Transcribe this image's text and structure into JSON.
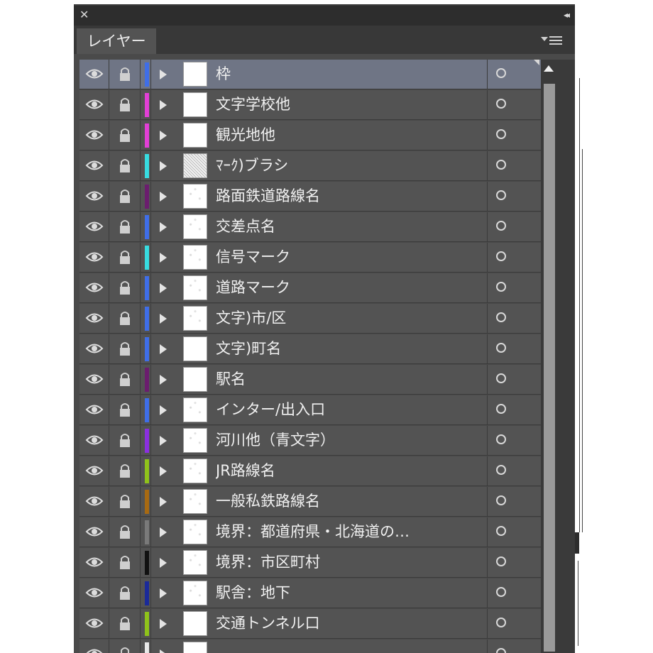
{
  "panel": {
    "close_glyph": "✕",
    "collapse_glyph": "◂◂",
    "tab_label": "レイヤー",
    "menu_icon": "panel-menu-icon"
  },
  "layers": [
    {
      "name": "枠",
      "color": "#3f6ee8",
      "selected": true,
      "thumb": "blank"
    },
    {
      "name": "文字学校他",
      "color": "#e23fd6",
      "selected": false,
      "thumb": "blank"
    },
    {
      "name": "観光地他",
      "color": "#e23fd6",
      "selected": false,
      "thumb": "blank"
    },
    {
      "name": "ﾏｰｸ)ブラシ",
      "color": "#37dce0",
      "selected": false,
      "thumb": "noisy"
    },
    {
      "name": "路面鉄道路線名",
      "color": "#6b1d6e",
      "selected": false,
      "thumb": "light"
    },
    {
      "name": "交差点名",
      "color": "#3f6ee8",
      "selected": false,
      "thumb": "light"
    },
    {
      "name": "信号マーク",
      "color": "#37dce0",
      "selected": false,
      "thumb": "light"
    },
    {
      "name": "道路マーク",
      "color": "#3f6ee8",
      "selected": false,
      "thumb": "light"
    },
    {
      "name": "文字)市/区",
      "color": "#3f6ee8",
      "selected": false,
      "thumb": "light"
    },
    {
      "name": "文字)町名",
      "color": "#3f6ee8",
      "selected": false,
      "thumb": "blank"
    },
    {
      "name": "駅名",
      "color": "#6b1d6e",
      "selected": false,
      "thumb": "blank"
    },
    {
      "name": "インター/出入口",
      "color": "#3f6ee8",
      "selected": false,
      "thumb": "light"
    },
    {
      "name": "河川他（青文字）",
      "color": "#8b2fe0",
      "selected": false,
      "thumb": "light"
    },
    {
      "name": "JR路線名",
      "color": "#8fc21a",
      "selected": false,
      "thumb": "light"
    },
    {
      "name": "一般私鉄路線名",
      "color": "#a86a12",
      "selected": false,
      "thumb": "light"
    },
    {
      "name": "境界：都道府県・北海道の…",
      "color": "#7a7a7a",
      "selected": false,
      "thumb": "light"
    },
    {
      "name": "境界：市区町村",
      "color": "#111111",
      "selected": false,
      "thumb": "light"
    },
    {
      "name": "駅舎：地下",
      "color": "#1a2a9a",
      "selected": false,
      "thumb": "light"
    },
    {
      "name": "交通トンネル口",
      "color": "#8fc21a",
      "selected": false,
      "thumb": "blank"
    },
    {
      "name": "",
      "color": "#e8e8e8",
      "selected": false,
      "thumb": "blank"
    }
  ]
}
